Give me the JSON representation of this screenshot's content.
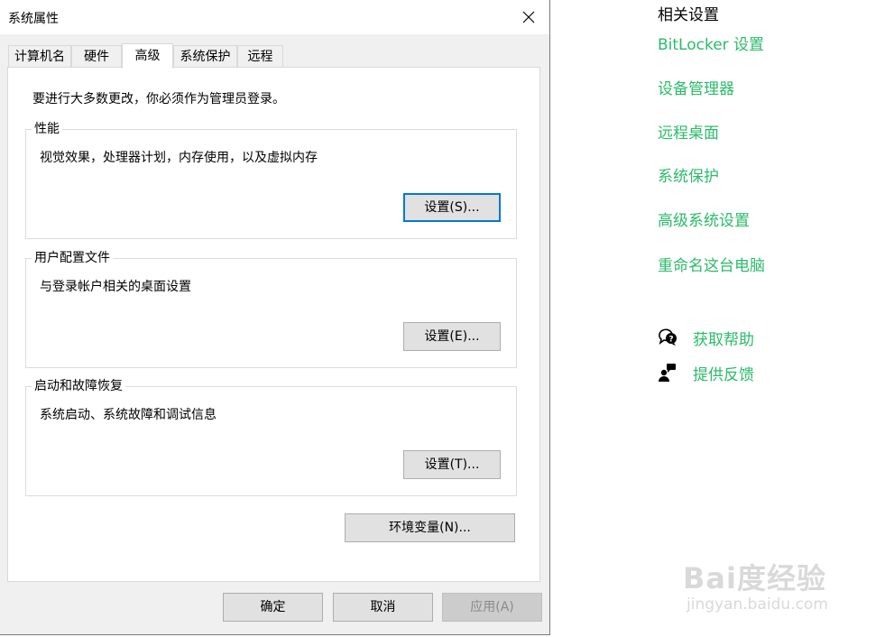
{
  "dialog": {
    "title": "系统属性",
    "tabs": [
      {
        "label": "计算机名",
        "active": false
      },
      {
        "label": "硬件",
        "active": false
      },
      {
        "label": "高级",
        "active": true
      },
      {
        "label": "系统保护",
        "active": false
      },
      {
        "label": "远程",
        "active": false
      }
    ],
    "admin_note": "要进行大多数更改，你必须作为管理员登录。",
    "groups": [
      {
        "title": "性能",
        "desc": "视觉效果，处理器计划，内存使用，以及虚拟内存",
        "button": "设置(S)..."
      },
      {
        "title": "用户配置文件",
        "desc": "与登录帐户相关的桌面设置",
        "button": "设置(E)..."
      },
      {
        "title": "启动和故障恢复",
        "desc": "系统启动、系统故障和调试信息",
        "button": "设置(T)..."
      }
    ],
    "env_button": "环境变量(N)...",
    "footer": {
      "ok": "确定",
      "cancel": "取消",
      "apply": "应用(A)"
    }
  },
  "related": {
    "title": "相关设置",
    "links": [
      "BitLocker 设置",
      "设备管理器",
      "远程桌面",
      "系统保护",
      "高级系统设置",
      "重命名这台电脑"
    ],
    "help": {
      "label": "获取帮助",
      "icon": "help-chat-icon"
    },
    "feedback": {
      "label": "提供反馈",
      "icon": "feedback-person-icon"
    },
    "link_color": "#2bbb6a"
  },
  "watermark": {
    "brand": "Bai度经验",
    "site": "jingyan.baidu.com"
  }
}
